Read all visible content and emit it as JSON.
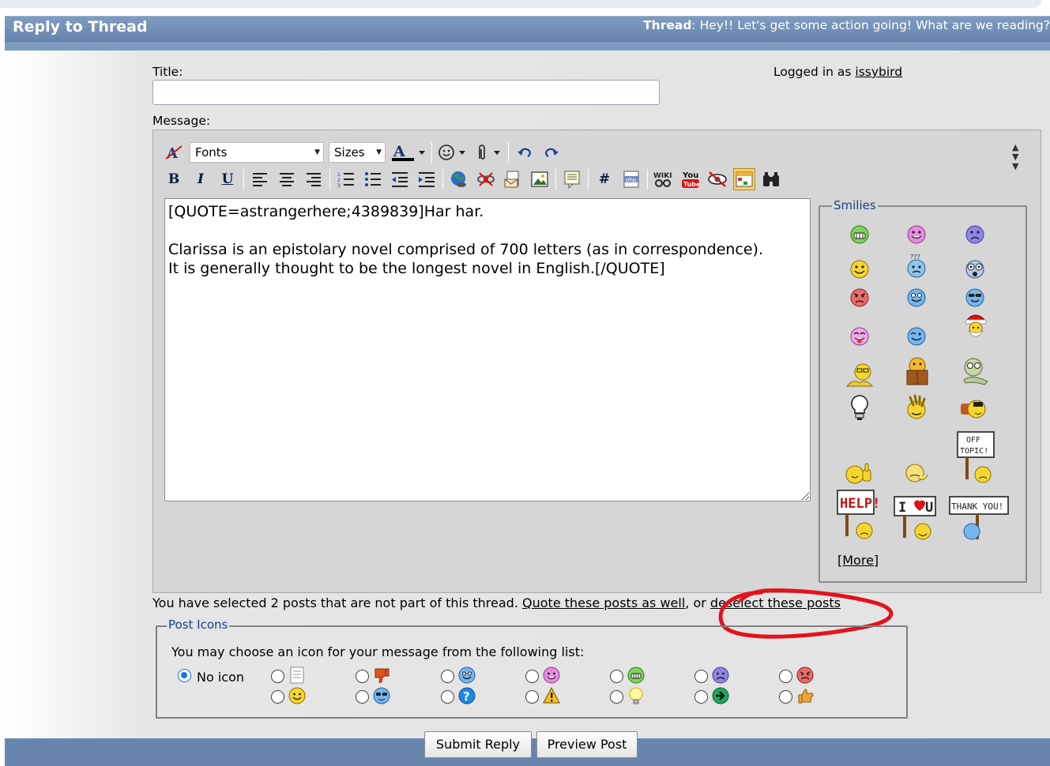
{
  "header": {
    "title": "Reply to Thread",
    "thread_label": "Thread",
    "thread_title": ": Hey!! Let's get some action going! What are we reading?"
  },
  "form": {
    "title_label": "Title:",
    "title_value": "",
    "logged_in_prefix": "Logged in as ",
    "username": "issybird",
    "message_label": "Message:"
  },
  "toolbar": {
    "fonts_label": "Fonts",
    "sizes_label": "Sizes",
    "bold": "B",
    "italic": "I",
    "underline": "U",
    "hash": "#"
  },
  "message": {
    "text": "[QUOTE=astrangerhere;4389839]Har har.\n\nClarissa is an epistolary novel comprised of 700 letters (as in correspondence).\nIt is generally thought to be the longest novel in English.[/QUOTE]"
  },
  "smilies": {
    "legend": "Smilies",
    "more_label": "[More]",
    "items": [
      "grin",
      "smile-pink",
      "sad-purple",
      "smile",
      "confused",
      "eek",
      "mad",
      "blue",
      "cool",
      "tongue",
      "wink",
      "santa",
      "reading-glasses",
      "book",
      "sleepy",
      "lightbulb",
      "wave",
      "sick",
      "offtopic",
      "thumbsup",
      "shrug",
      "help",
      "i-love-u",
      "thank-you"
    ],
    "sign_offtopic": "OFF TOPIC!",
    "sign_help": "HELP!",
    "sign_iu_1": "I",
    "sign_iu_2": "U",
    "sign_thanks": "THANK YOU!"
  },
  "selection_note": {
    "prefix": "You have selected 2 posts that are not part of this thread. ",
    "quote_link": "Quote these posts as well",
    "middle": ", or ",
    "deselect_link": "deselect these posts"
  },
  "post_icons": {
    "legend": "Post Icons",
    "instruction": "You may choose an icon for your message from the following list:",
    "no_icon_label": "No icon",
    "selected": "No icon"
  },
  "buttons": {
    "submit": "Submit Reply",
    "preview": "Preview Post"
  },
  "colors": {
    "header_bg": "#7390b6",
    "link_blue": "#1e3f8a",
    "annotation_red": "#e3121b",
    "radio_selected": "#1a73e8"
  }
}
